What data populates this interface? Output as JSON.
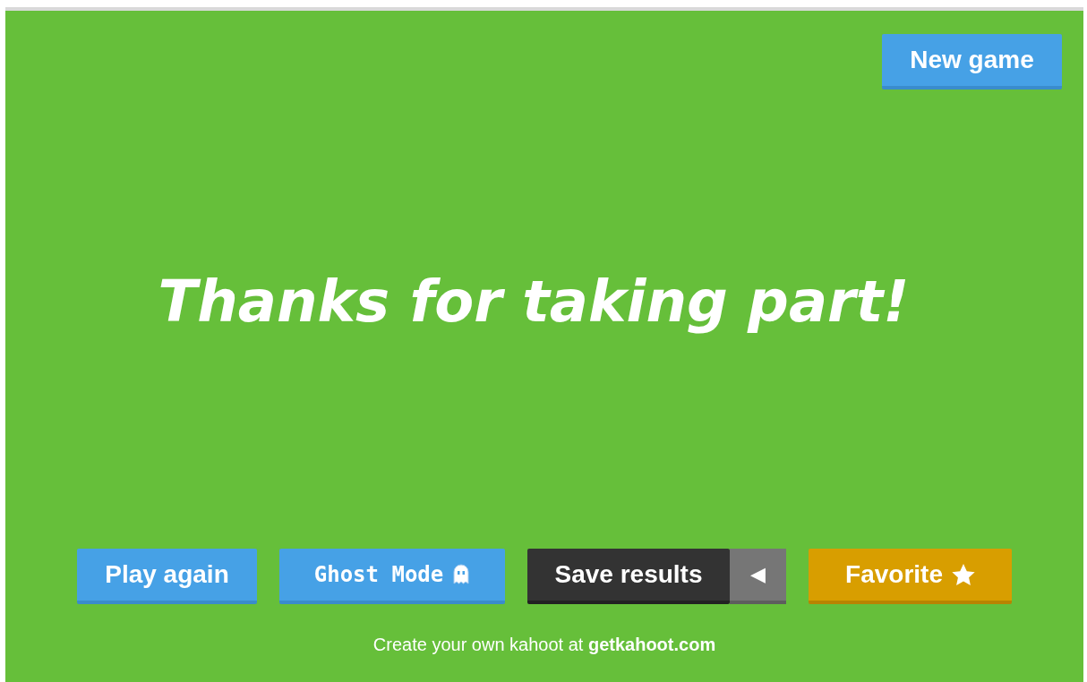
{
  "header": {
    "new_game_button": "New game"
  },
  "message": "Thanks for taking part!",
  "actions": [
    {
      "kind": "play",
      "label": "Play again"
    },
    {
      "kind": "ghost",
      "label": "Ghost Mode"
    },
    {
      "kind": "save",
      "label": "Save results",
      "toggle": "◀"
    },
    {
      "kind": "favorite",
      "label": "Favorite"
    }
  ],
  "footer": "Create your own kahoot at **getkahoot.com**"
}
